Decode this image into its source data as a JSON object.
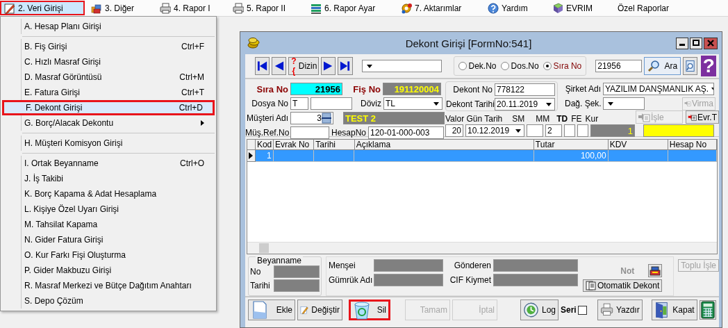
{
  "menu_bar": [
    {
      "label": "2. Veri Girişi",
      "selected": true,
      "highlighted": true
    },
    {
      "label": "3. Diğer",
      "selected": false,
      "highlighted": false
    },
    {
      "label": "4. Rapor I",
      "selected": false,
      "highlighted": false
    },
    {
      "label": "5. Rapor II",
      "selected": false,
      "highlighted": false
    },
    {
      "label": "6. Rapor Ayar",
      "selected": false,
      "highlighted": false
    },
    {
      "label": "7. Aktarımlar",
      "selected": false,
      "highlighted": false
    },
    {
      "label": "Yardım",
      "selected": false,
      "highlighted": false
    },
    {
      "label": "EVRIM",
      "selected": false,
      "highlighted": false
    },
    {
      "label": "Özel Raporlar",
      "selected": false,
      "highlighted": false
    }
  ],
  "dropdown": {
    "groups": [
      [
        {
          "label": "A. Hesap Planı Girişi",
          "selected": false,
          "highlighted": false,
          "submenu": false
        }
      ],
      [
        {
          "label": "B. Fiş Girişi",
          "shortcut": "Ctrl+F",
          "selected": false,
          "highlighted": false,
          "submenu": false
        },
        {
          "label": "C. Hızlı Masraf Girişi",
          "selected": false,
          "highlighted": false,
          "submenu": false
        },
        {
          "label": "D. Masraf Görüntüsü",
          "shortcut": "Ctrl+M",
          "selected": false,
          "highlighted": false,
          "submenu": false
        },
        {
          "label": "E. Fatura Girişi",
          "shortcut": "Ctrl+T",
          "selected": false,
          "highlighted": false,
          "submenu": false
        },
        {
          "label": "F. Dekont Girişi",
          "shortcut": "Ctrl+D",
          "selected": true,
          "highlighted": true,
          "submenu": false
        },
        {
          "label": "G. Borç/Alacak Dekontu",
          "selected": false,
          "highlighted": false,
          "submenu": true
        }
      ],
      [
        {
          "label": "H. Müşteri Komisyon Girişi",
          "selected": false,
          "highlighted": false,
          "submenu": false
        }
      ],
      [
        {
          "label": "I. Ortak Beyanname",
          "shortcut": "Ctrl+O",
          "selected": false,
          "highlighted": false,
          "submenu": false
        },
        {
          "label": "J. İş Takibi",
          "selected": false,
          "highlighted": false,
          "submenu": false
        },
        {
          "label": "K. Borç Kapama & Adat Hesaplama",
          "selected": false,
          "highlighted": false,
          "submenu": false
        },
        {
          "label": "L. Kişiye Özel Uyarı Girişi",
          "selected": false,
          "highlighted": false,
          "submenu": false
        },
        {
          "label": "M. Tahsilat Kapama",
          "selected": false,
          "highlighted": false,
          "submenu": false
        },
        {
          "label": "N. Gider Fatura Girişi",
          "selected": false,
          "highlighted": false,
          "submenu": false
        },
        {
          "label": "O. Kur Farkı Fişi Oluşturma",
          "selected": false,
          "highlighted": false,
          "submenu": false
        },
        {
          "label": "P. Gider Makbuzu Girişi",
          "selected": false,
          "highlighted": false,
          "submenu": false
        },
        {
          "label": "R. Masraf Merkezi ve Bütçe Dağıtım Anahtarı",
          "selected": false,
          "highlighted": false,
          "submenu": false
        },
        {
          "label": "S. Depo Çözüm",
          "selected": false,
          "highlighted": false,
          "submenu": false
        }
      ]
    ]
  },
  "form": {
    "title": "Dekont Girişi [FormNo:541]",
    "toolbar": {
      "index_glyph": "?{",
      "index_button": "Dizin",
      "search_by": [
        {
          "label": "Dek.No",
          "selected": false
        },
        {
          "label": "Dos.No",
          "selected": false
        },
        {
          "label": "Sıra No",
          "selected": true
        }
      ],
      "search_value": "21956",
      "search_button": "Ara",
      "help_glyph": "?"
    },
    "fields": {
      "sira_no": {
        "label": "Sıra No",
        "value": "21956"
      },
      "fis_no": {
        "label": "Fiş No",
        "value": "191120004"
      },
      "dosya_no": {
        "label": "Dosya No",
        "value": "T"
      },
      "doviz": {
        "label": "Döviz",
        "value": "TL"
      },
      "musteri": {
        "label": "Müşteri Adı",
        "value": "3",
        "name": "TEST 2"
      },
      "mus_ref_no": {
        "label": "Müş.Ref.No"
      },
      "hesap_no": {
        "label": "HesapNo",
        "value": "120-01-000-003"
      },
      "dekont_no": {
        "label": "Dekont No",
        "value": "778122"
      },
      "dekont_tarihi": {
        "label": "Dekont Tarihi",
        "value": "20.11.2019"
      },
      "sirket_adi": {
        "label": "Şirket Adı",
        "value": "YAZILIM DANŞMANLIK AŞ."
      },
      "dag_sek": {
        "label": "Dağ. Şek."
      },
      "valor": {
        "label": "Valor Gün Tarih",
        "days": "20",
        "date": "10.12.2019"
      },
      "sm": {
        "label": "SM"
      },
      "mm": {
        "label": "MM",
        "value": "2"
      },
      "td": {
        "label": "TD"
      },
      "fe": {
        "label": "FE"
      },
      "kur": {
        "label": "Kur",
        "value": "1"
      }
    },
    "side_buttons": [
      {
        "label": "Virma",
        "disabled": true
      },
      {
        "label": "İşle",
        "disabled": true
      },
      {
        "label": "Evr.T",
        "disabled": false
      }
    ],
    "grid": {
      "columns": [
        "Kod",
        "Evrak No",
        "Tarihi",
        "Açıklama",
        "Tutar",
        "KDV",
        "Hesap No"
      ],
      "rows": [
        {
          "selected": true,
          "cells": [
            "1",
            "",
            "",
            "",
            "100,00",
            "",
            ""
          ]
        }
      ]
    },
    "customs": {
      "title": "Beyanname",
      "no_label": "No",
      "date_label": "Tarihi",
      "origin_label": "Menşei",
      "customs_label": "Gümrük Adı",
      "sender_label": "Gönderen",
      "cif_label": "CIF Kiymet"
    },
    "note_label": "Not",
    "auto_button": "Otomatik Dekont",
    "bulk_button": {
      "label": "Toplu İşle",
      "disabled": true
    },
    "actions": [
      {
        "kind": "button",
        "label": "Ekle",
        "disabled": false,
        "highlighted": false
      },
      {
        "kind": "button",
        "label": "Değiştir",
        "disabled": false,
        "highlighted": false
      },
      {
        "kind": "button",
        "label": "Sil",
        "disabled": false,
        "highlighted": true
      },
      {
        "kind": "button",
        "label": "Tamam",
        "disabled": true,
        "highlighted": false
      },
      {
        "kind": "button",
        "label": "İptal",
        "disabled": true,
        "highlighted": false
      },
      {
        "kind": "button",
        "label": "Log",
        "disabled": false,
        "highlighted": false
      },
      {
        "kind": "checkbox",
        "label": "Seri",
        "checked": false
      },
      {
        "kind": "button",
        "label": "Yazdır",
        "disabled": false,
        "highlighted": false
      },
      {
        "kind": "button",
        "label": "Kapat",
        "disabled": false,
        "highlighted": false
      },
      {
        "kind": "icon_button",
        "disabled": false,
        "highlighted": false
      }
    ]
  }
}
